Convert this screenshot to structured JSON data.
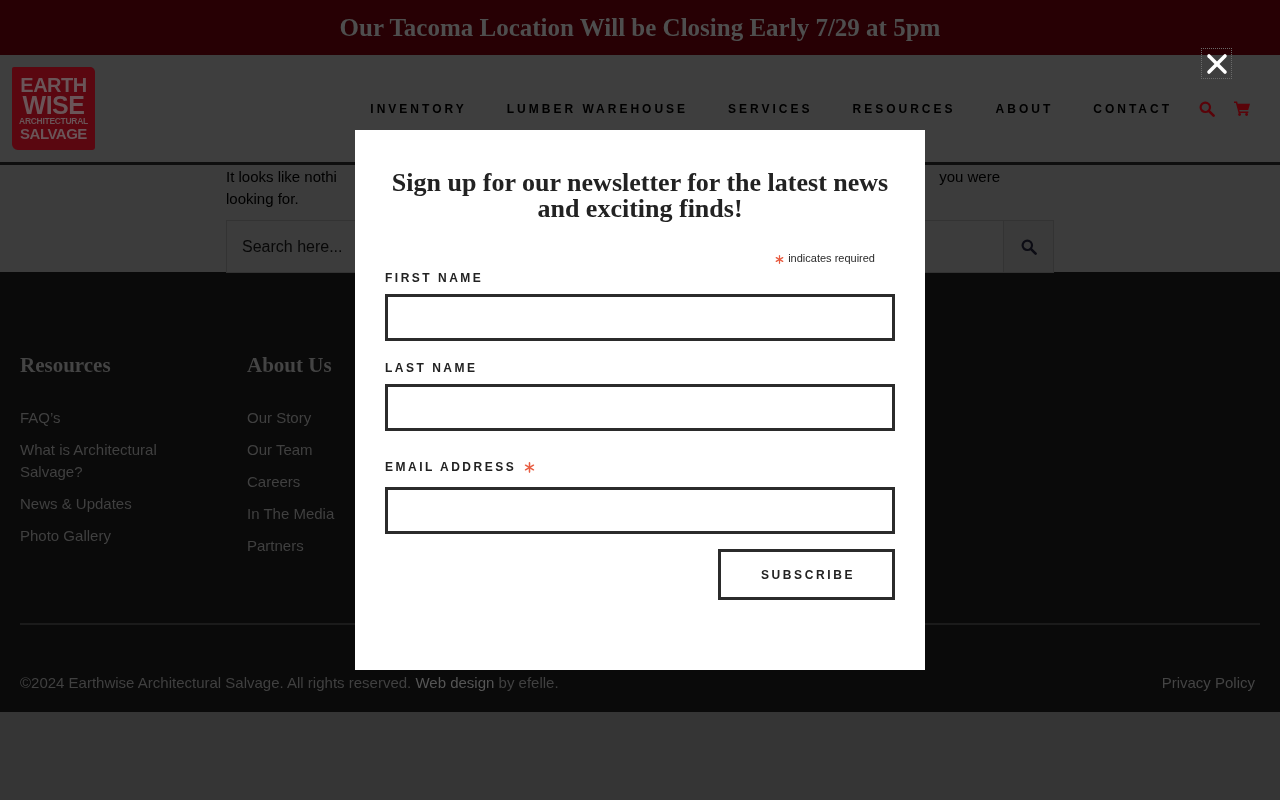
{
  "announcement_bar": {
    "text": "Our Tacoma Location Will be Closing Early 7/29 at 5pm"
  },
  "header": {
    "logo": {
      "lines": [
        "EARTH",
        "WISE",
        "ARCHITECTURAL",
        "SALVAGE"
      ]
    },
    "nav": [
      {
        "label": "INVENTORY"
      },
      {
        "label": "LUMBER WAREHOUSE"
      },
      {
        "label": "SERVICES"
      },
      {
        "label": "RESOURCES"
      },
      {
        "label": "ABOUT"
      },
      {
        "label": "CONTACT"
      }
    ]
  },
  "content": {
    "message": {
      "line_1_left": "It looks like nothi",
      "line_1_right": "you were",
      "line_2": "looking for."
    },
    "search": {
      "placeholder": "Search here..."
    }
  },
  "footer": {
    "columns": [
      {
        "title": "Resources",
        "links": [
          "FAQ’s",
          "What is Architectural Salvage?",
          "News & Updates",
          "Photo Gallery"
        ]
      },
      {
        "title": "About Us",
        "links": [
          "Our Story",
          "Our Team",
          "Careers",
          "In The Media",
          "Partners"
        ]
      }
    ],
    "copyright": {
      "text_before": "©2024 Earthwise Architectural Salvage. All rights reserved.",
      "link": "Web design",
      "text_after": "by efelle."
    },
    "privacy_link": "Privacy Policy"
  },
  "modal": {
    "close_button": {
      "focused": true
    },
    "title": "Sign up for our newsletter for the latest news and exciting finds!",
    "required_note": "indicates required",
    "fields": [
      {
        "label": "FIRST NAME",
        "required": false
      },
      {
        "label": "LAST NAME",
        "required": false
      },
      {
        "label": "EMAIL ADDRESS",
        "required": true
      }
    ],
    "submit": "SUBSCRIBE"
  }
}
